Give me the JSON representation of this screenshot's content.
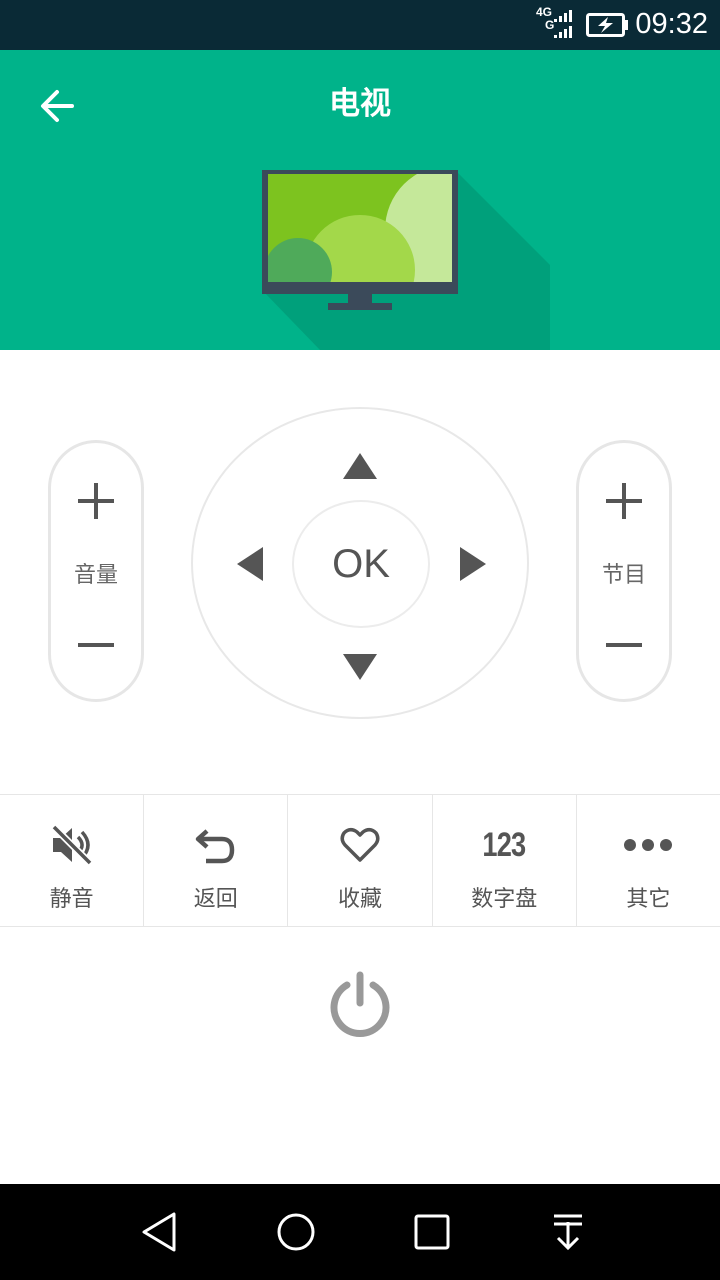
{
  "status_bar": {
    "network_top": "4G",
    "network_bottom": "G",
    "time": "09:32"
  },
  "header": {
    "title": "电视",
    "background_color": "#00b38a"
  },
  "remote": {
    "volume_label": "音量",
    "ok_label": "OK",
    "channel_label": "节目"
  },
  "functions": [
    {
      "label": "静音",
      "icon": "mute-icon"
    },
    {
      "label": "返回",
      "icon": "return-icon"
    },
    {
      "label": "收藏",
      "icon": "heart-icon"
    },
    {
      "label": "数字盘",
      "icon": "numpad-icon",
      "icon_text": "123"
    },
    {
      "label": "其它",
      "icon": "more-icon"
    }
  ],
  "power": {
    "icon": "power-icon"
  },
  "system_nav": [
    "back-icon",
    "home-icon",
    "recents-icon",
    "notification-icon"
  ]
}
